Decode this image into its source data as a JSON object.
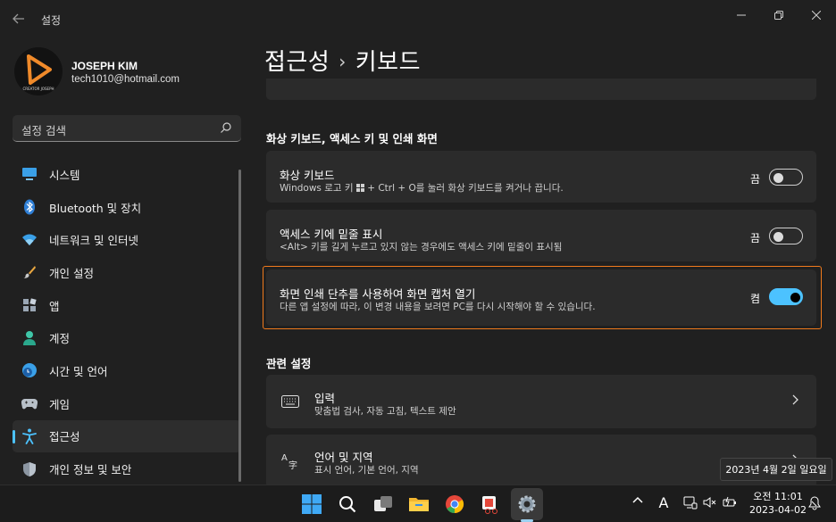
{
  "window": {
    "app_title": "설정"
  },
  "profile": {
    "name": "JOSEPH KIM",
    "email": "tech1010@hotmail.com",
    "avatar_text": "CREATOR JOSEPH"
  },
  "search": {
    "placeholder": "설정 검색"
  },
  "sidebar": {
    "items": [
      {
        "label": "시스템",
        "icon": "monitor-icon"
      },
      {
        "label": "Bluetooth 및 장치",
        "icon": "bluetooth-icon"
      },
      {
        "label": "네트워크 및 인터넷",
        "icon": "wifi-icon"
      },
      {
        "label": "개인 설정",
        "icon": "brush-icon"
      },
      {
        "label": "앱",
        "icon": "apps-icon"
      },
      {
        "label": "계정",
        "icon": "person-icon"
      },
      {
        "label": "시간 및 언어",
        "icon": "globe-clock-icon"
      },
      {
        "label": "게임",
        "icon": "gamepad-icon"
      },
      {
        "label": "접근성",
        "icon": "accessibility-icon"
      },
      {
        "label": "개인 정보 및 보안",
        "icon": "shield-icon"
      }
    ],
    "active_index": 8
  },
  "breadcrumb": {
    "parent": "접근성",
    "separator": "›",
    "current": "키보드"
  },
  "sections": {
    "osk_title": "화상 키보드, 액세스 키 및 인쇄 화면",
    "related_title": "관련 설정"
  },
  "settings": [
    {
      "title": "화상 키보드",
      "desc_before": "Windows 로고 키 ",
      "desc_after": " + Ctrl + O를 눌러 화상 키보드를 켜거나 끕니다.",
      "state": "끔",
      "on": false
    },
    {
      "title": "액세스 키에 밑줄 표시",
      "desc": "<Alt> 키를 길게 누르고 있지 않는 경우에도 액세스 키에 밑줄이 표시됨",
      "state": "끔",
      "on": false
    },
    {
      "title": "화면 인쇄 단추를 사용하여 화면 캡처 열기",
      "desc": "다른 앱 설정에 따라, 이 변경 내용을 보려면 PC를 다시 시작해야 할 수 있습니다.",
      "state": "켬",
      "on": true
    }
  ],
  "related": [
    {
      "title": "입력",
      "desc": "맞춤법 검사, 자동 고침, 텍스트 제안",
      "icon": "keyboard-icon"
    },
    {
      "title": "언어 및 지역",
      "desc": "표시 언어, 기본 언어, 지역",
      "icon": "language-icon"
    }
  ],
  "tooltip": {
    "date_long": "2023년 4월 2일 일요일"
  },
  "taskbar": {
    "tray_ime": "A",
    "clock_time": "오전 11:01",
    "clock_date": "2023-04-02"
  },
  "colors": {
    "accent": "#4cc2ff",
    "highlight_border": "#f07a1c",
    "card_bg": "#2b2b2b",
    "window_bg": "#202020"
  }
}
